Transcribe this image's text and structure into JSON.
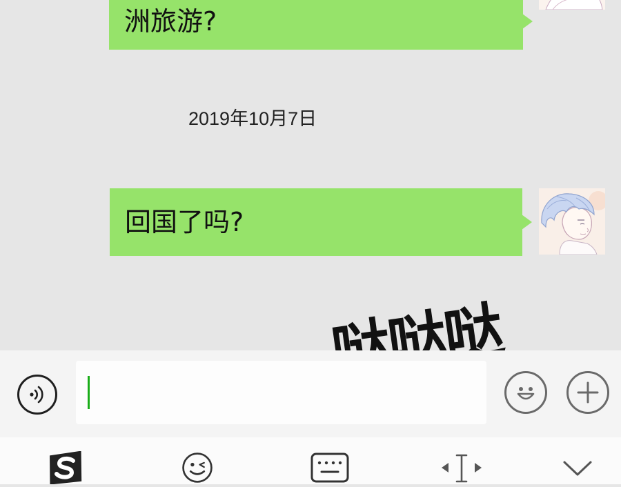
{
  "chat": {
    "messages": [
      {
        "text": "洲旅游?",
        "side": "right",
        "bubble_color": "#96e36a"
      },
      {
        "text": "回国了吗?",
        "side": "right",
        "bubble_color": "#96e36a"
      }
    ],
    "timestamp": "2019年10月7日",
    "background_color": "#e6e6e6"
  },
  "overlay": {
    "sound_effect": "哒哒哒"
  },
  "input_bar": {
    "voice_icon": "voice-icon",
    "message_value": "",
    "emoji_icon": "emoji-smiley-icon",
    "plus_icon": "plus-icon",
    "caret_color": "#1aad19"
  },
  "keyboard_toolbar": {
    "icons": [
      "sogou-logo-icon",
      "wink-emoji-icon",
      "keyboard-icon",
      "text-cursor-icon",
      "chevron-down-icon"
    ]
  }
}
